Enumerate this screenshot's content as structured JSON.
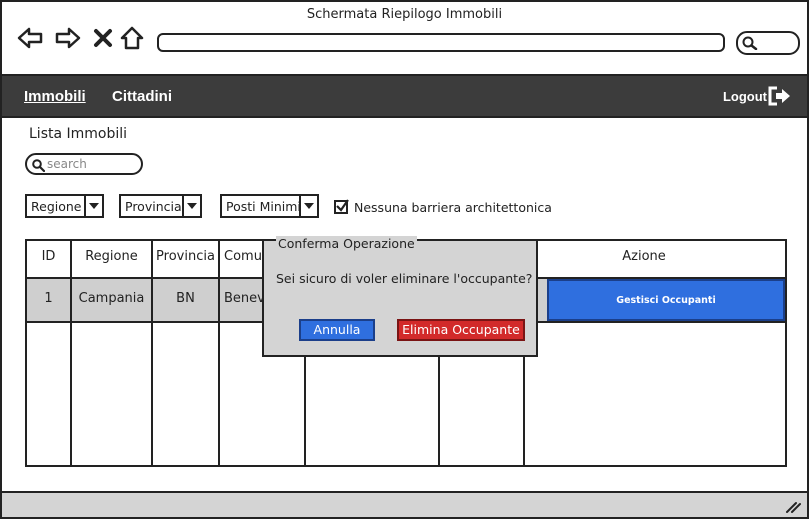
{
  "window": {
    "title": "Schermata Riepilogo Immobili"
  },
  "browser": {
    "back_icon": "back-arrow-icon",
    "forward_icon": "forward-arrow-icon",
    "stop_icon": "close-icon",
    "home_icon": "home-icon",
    "address_value": "",
    "search_icon": "search-icon"
  },
  "navbar": {
    "items": [
      {
        "label": "Immobili",
        "active": true
      },
      {
        "label": "Cittadini",
        "active": false
      }
    ],
    "logout_label": "Logout",
    "logout_icon": "logout-icon"
  },
  "main": {
    "title": "Lista Immobili",
    "search": {
      "placeholder": "search",
      "icon": "search-icon"
    },
    "filters": [
      {
        "label": "Regione"
      },
      {
        "label": "Provincia"
      },
      {
        "label": "Posti Minimi"
      }
    ],
    "checkbox": {
      "label": "Nessuna barriera architettonica",
      "checked": true
    }
  },
  "table": {
    "headers": [
      "ID",
      "Regione",
      "Provincia",
      "Comune",
      "",
      "",
      "Azione"
    ],
    "rows": [
      {
        "id": "1",
        "regione": "Campania",
        "provincia": "BN",
        "comune": "Benevento",
        "action_label": "Gestisci Occupanti"
      }
    ]
  },
  "dialog": {
    "title": "Conferma Operazione",
    "message": "Sei sicuro di voler eliminare l'occupante?",
    "cancel_label": "Annulla",
    "confirm_label": "Elimina Occupante"
  },
  "colors": {
    "navbar_bg": "#3c3c3c",
    "primary_button": "#2f6fdf",
    "danger_button": "#d22a2a",
    "selected_row": "#cfcfcf",
    "dialog_bg": "#d4d4d4"
  }
}
